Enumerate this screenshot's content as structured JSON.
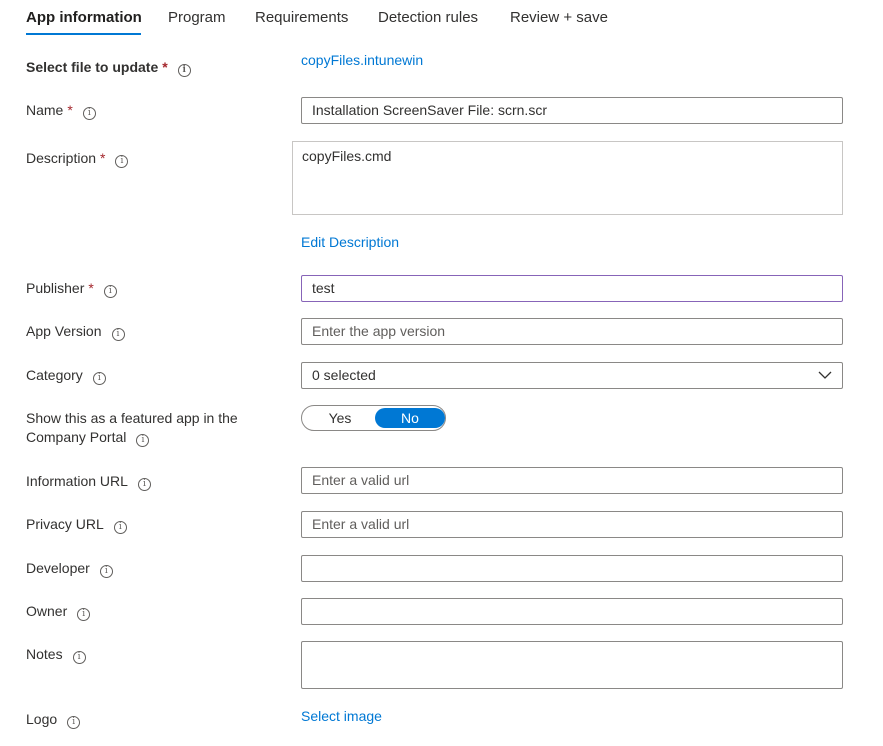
{
  "tabs": [
    {
      "label": "App information"
    },
    {
      "label": "Program"
    },
    {
      "label": "Requirements"
    },
    {
      "label": "Detection rules"
    },
    {
      "label": "Review + save"
    }
  ],
  "form": {
    "select_file": {
      "label": "Select file to update",
      "value": "copyFiles.intunewin"
    },
    "name": {
      "label": "Name",
      "value": "Installation ScreenSaver File: scrn.scr"
    },
    "description": {
      "label": "Description",
      "value": "copyFiles.cmd",
      "edit_link": "Edit Description"
    },
    "publisher": {
      "label": "Publisher",
      "value": "test"
    },
    "app_version": {
      "label": "App Version",
      "placeholder": "Enter the app version"
    },
    "category": {
      "label": "Category",
      "value": "0 selected"
    },
    "featured": {
      "label_line1": "Show this as a featured app in the",
      "label_line2": "Company Portal",
      "yes": "Yes",
      "no": "No",
      "selected": "No"
    },
    "information_url": {
      "label": "Information URL",
      "placeholder": "Enter a valid url"
    },
    "privacy_url": {
      "label": "Privacy URL",
      "placeholder": "Enter a valid url"
    },
    "developer": {
      "label": "Developer",
      "value": ""
    },
    "owner": {
      "label": "Owner",
      "value": ""
    },
    "notes": {
      "label": "Notes",
      "value": ""
    },
    "logo": {
      "label": "Logo",
      "link": "Select image"
    }
  },
  "required_mark": "*",
  "info_glyph": "i",
  "colors": {
    "accent": "#0078d4",
    "required": "#a4262c",
    "focus_border": "#8764b8"
  }
}
